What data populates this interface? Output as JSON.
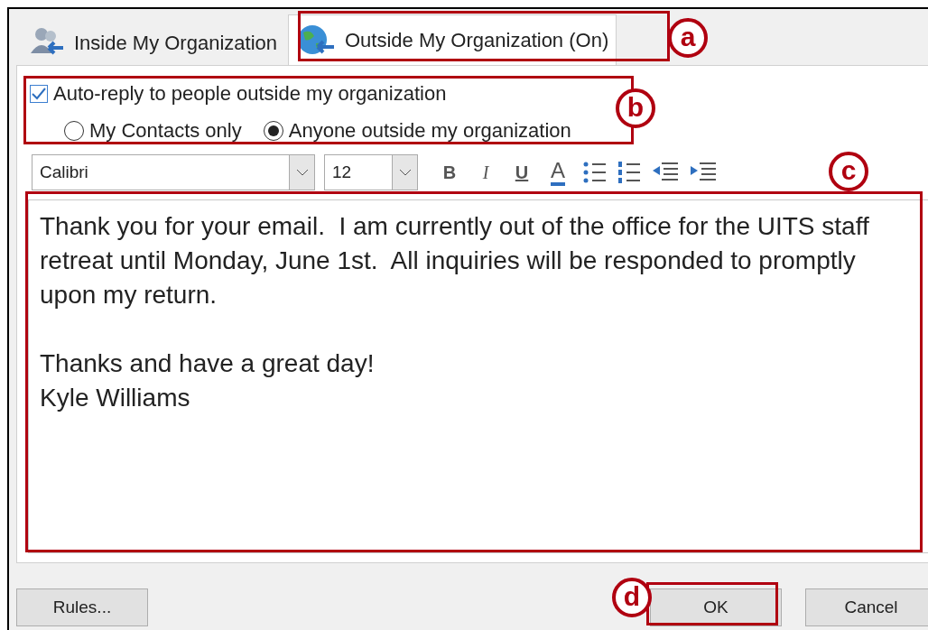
{
  "tabs": [
    {
      "label": "Inside My Organization",
      "selected": false
    },
    {
      "label": "Outside My Organization (On)",
      "selected": true
    }
  ],
  "auto_reply": {
    "label": "Auto-reply to people outside my organization",
    "checked": true
  },
  "audience": [
    {
      "label": "My Contacts only",
      "selected": false
    },
    {
      "label": "Anyone outside my organization",
      "selected": true
    }
  ],
  "toolbar": {
    "font": "Calibri",
    "size": "12",
    "format_buttons": [
      "B",
      "I",
      "U",
      "A"
    ]
  },
  "message": {
    "paragraphs": [
      {
        "lines": [
          "Thank you for your email.  I am currently out of the office for the UITS staff",
          "retreat until Monday, June 1st.  All inquiries will be responded to promptly",
          "upon my return."
        ]
      },
      {
        "lines": [
          "Thanks and have a great day!",
          "Kyle Williams"
        ]
      }
    ]
  },
  "buttons": [
    {
      "label": "Rules...",
      "kind": "left"
    },
    {
      "label": "OK",
      "kind": "right"
    },
    {
      "label": "Cancel",
      "kind": "right"
    }
  ],
  "annotations": [
    "a",
    "b",
    "c",
    "d"
  ]
}
